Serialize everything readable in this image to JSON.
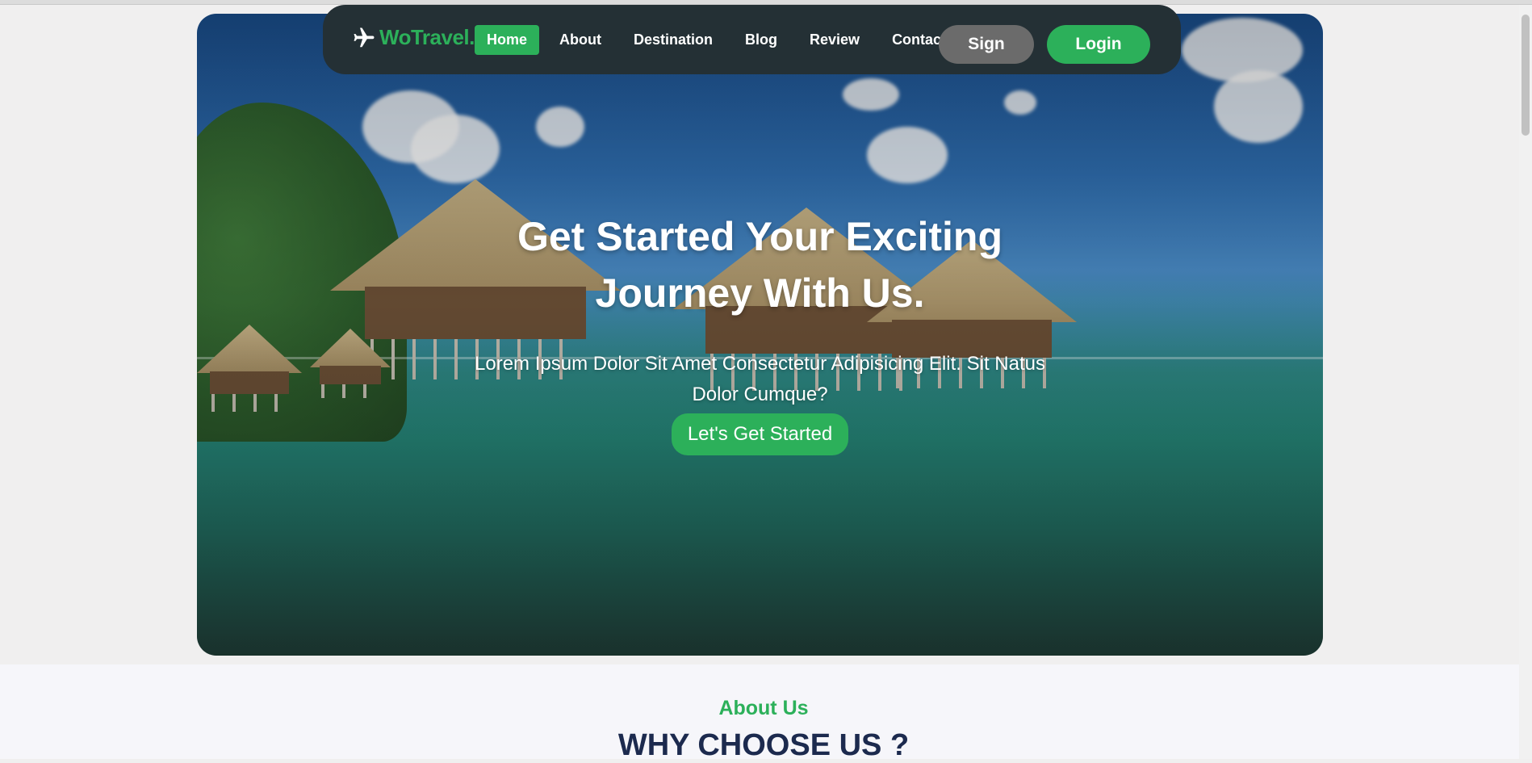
{
  "brand": {
    "name": "WoTravel.",
    "icon": "airplane-icon",
    "color": "#2cb05a"
  },
  "nav": {
    "items": [
      {
        "label": "Home",
        "active": true
      },
      {
        "label": "About",
        "active": false
      },
      {
        "label": "Destination",
        "active": false
      },
      {
        "label": "Blog",
        "active": false
      },
      {
        "label": "Review",
        "active": false
      },
      {
        "label": "Contact",
        "active": false
      }
    ],
    "sign_label": "Sign",
    "login_label": "Login"
  },
  "hero": {
    "title": "Get Started Your Exciting Journey With Us.",
    "subtitle": "Lorem Ipsum Dolor Sit Amet Consectetur Adipisicing Elit. Sit Natus Dolor Cumque?",
    "cta_label": "Let's Get Started"
  },
  "about": {
    "label": "About Us",
    "title": "WHY CHOOSE US ?"
  },
  "colors": {
    "accent": "#2cb05a",
    "navbar": "#243035",
    "sign_button": "#6b6b6b",
    "heading_dark": "#1c2a4e"
  }
}
